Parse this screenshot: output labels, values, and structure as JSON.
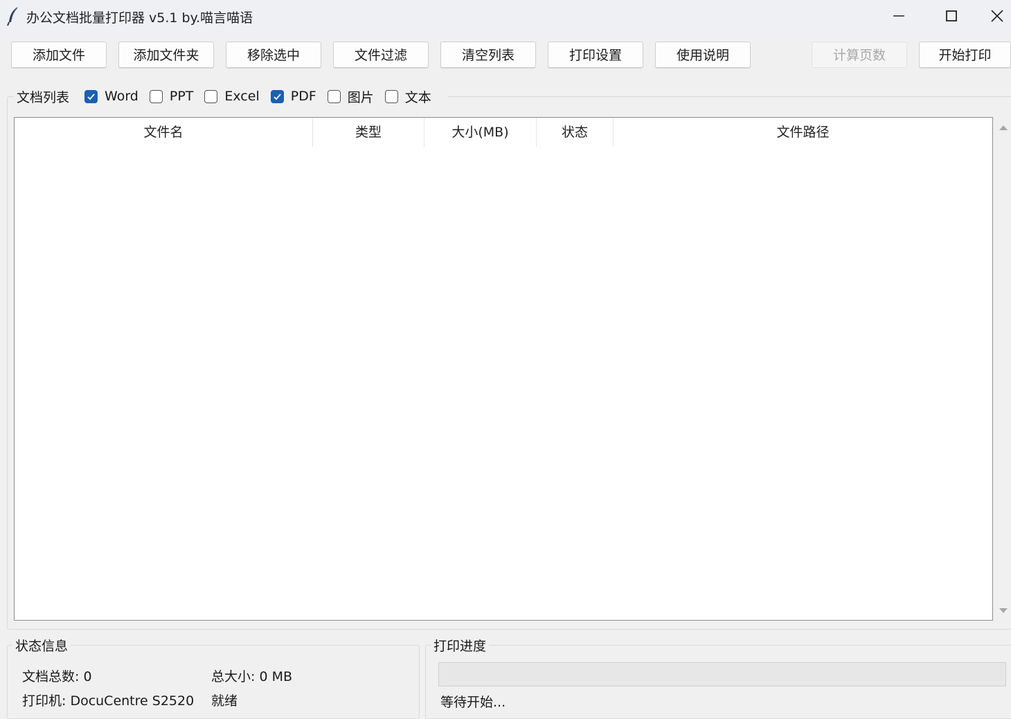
{
  "window": {
    "title": "办公文档批量打印器 v5.1 by.喵言喵语",
    "icon": "feather-icon"
  },
  "toolbar": {
    "add_file": "添加文件",
    "add_folder": "添加文件夹",
    "remove_selected": "移除选中",
    "file_filter": "文件过滤",
    "clear_list": "清空列表",
    "print_settings": "打印设置",
    "usage_help": "使用说明",
    "count_pages": "计算页数",
    "start_print": "开始打印"
  },
  "doc_list": {
    "title": "文档列表",
    "filters": [
      {
        "label": "Word",
        "checked": true
      },
      {
        "label": "PPT",
        "checked": false
      },
      {
        "label": "Excel",
        "checked": false
      },
      {
        "label": "PDF",
        "checked": true
      },
      {
        "label": "图片",
        "checked": false
      },
      {
        "label": "文本",
        "checked": false
      }
    ],
    "columns": [
      "文件名",
      "类型",
      "大小(MB)",
      "状态",
      "文件路径"
    ],
    "rows": []
  },
  "status_info": {
    "title": "状态信息",
    "doc_count": "文档总数: 0",
    "total_size": "总大小: 0 MB",
    "printer": "打印机: DocuCentre S2520",
    "state": "就绪"
  },
  "print_progress": {
    "title": "打印进度",
    "progress": 0,
    "status_text": "等待开始..."
  },
  "colors": {
    "accent": "#1a5fb4",
    "background": "#f0f0f0"
  }
}
